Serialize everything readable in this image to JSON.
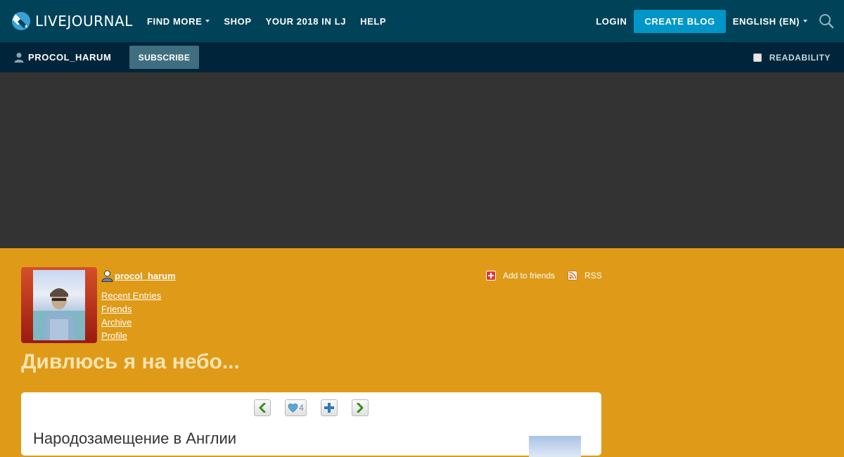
{
  "topbar": {
    "logo_text": "LIVEJOURNAL",
    "nav": {
      "find_more": "FIND MORE",
      "shop": "SHOP",
      "year_in_lj": "YOUR 2018 IN LJ",
      "help": "HELP"
    },
    "login": "LOGIN",
    "create_blog": "CREATE BLOG",
    "language": "ENGLISH (EN)",
    "icons": {
      "logo": "livejournal-logo-icon",
      "search": "search-icon",
      "dropdown": "chevron-down-icon"
    }
  },
  "subbar": {
    "journal_user": "PROCOL_HARUM",
    "subscribe": "SUBSCRIBE",
    "readability": "READABILITY",
    "readability_checked": false
  },
  "journal": {
    "username": "procol_harum",
    "links": {
      "recent_entries": "Recent Entries",
      "friends": "Friends",
      "archive": "Archive",
      "profile": "Profile"
    },
    "add_to_friends": "Add to friends",
    "rss": "RSS",
    "title": "Дивлюсь я на небо..."
  },
  "entry": {
    "like_count": "4",
    "title": "Народозамещение в Англии",
    "icons": {
      "prev": "arrow-left-icon",
      "like": "heart-icon",
      "memory": "plus-icon",
      "next": "arrow-right-icon"
    }
  },
  "colors": {
    "topbar": "#004359",
    "subbar": "#00253a",
    "banner": "#333333",
    "page_background": "#df9a18",
    "accent_button": "#0096c8",
    "subscribe_button": "#3f6e80"
  }
}
